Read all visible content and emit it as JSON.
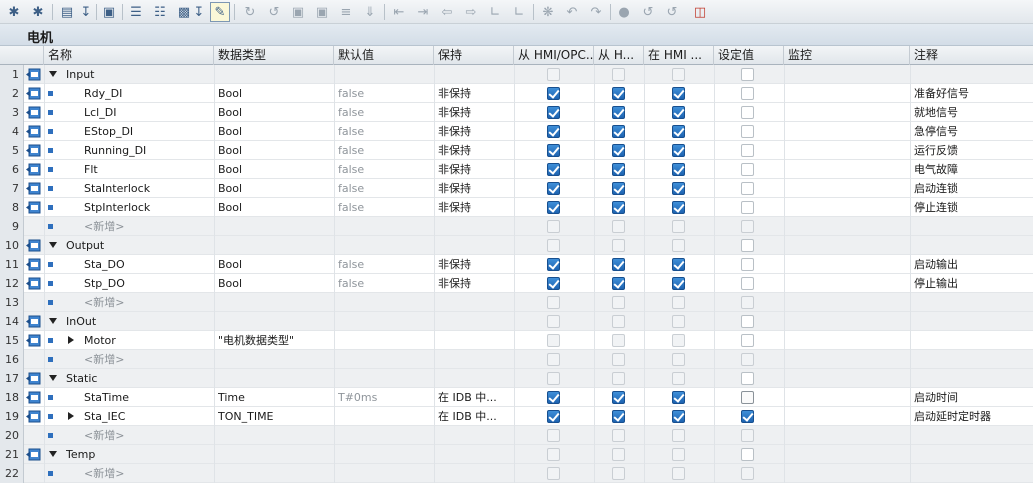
{
  "block_title": "电机",
  "toolbar": {
    "icons": [
      "insert-row-icon",
      "add-row-icon",
      "expand-icon",
      "monitor-icon",
      "list-icon",
      "download-icon",
      "snapshot-icon",
      "load-start-values-icon",
      "highlight-icon",
      "reset-icon",
      "jump-icon",
      "copy-icon",
      "paste-icon",
      "format-icon",
      "filter-icon",
      "indent-left-icon",
      "indent-right-icon",
      "outdent-icon",
      "sort-icon",
      "tree-icon",
      "comment-icon",
      "undo-icon",
      "redo-icon",
      "link-icon",
      "compare-icon",
      "compare2-icon",
      "db-icon"
    ]
  },
  "columns": [
    "名称",
    "数据类型",
    "默认值",
    "保持",
    "从 HMI/OPC...",
    "从 H...",
    "在 HMI ...",
    "设定值",
    "监控",
    "注释"
  ],
  "rows": [
    {
      "num": "1",
      "kind": "section",
      "name": "Input",
      "type": "",
      "default": "",
      "retain": "",
      "c1": "disabled",
      "c2": "disabled",
      "c3": "disabled",
      "c4": "off",
      "comment": ""
    },
    {
      "num": "2",
      "kind": "var",
      "name": "Rdy_DI",
      "type": "Bool",
      "default": "false",
      "retain": "非保持",
      "c1": "on",
      "c2": "on",
      "c3": "on",
      "c4": "off",
      "comment": "准备好信号"
    },
    {
      "num": "3",
      "kind": "var",
      "name": "Lcl_DI",
      "type": "Bool",
      "default": "false",
      "retain": "非保持",
      "c1": "on",
      "c2": "on",
      "c3": "on",
      "c4": "off",
      "comment": "就地信号"
    },
    {
      "num": "4",
      "kind": "var",
      "name": "EStop_DI",
      "type": "Bool",
      "default": "false",
      "retain": "非保持",
      "c1": "on",
      "c2": "on",
      "c3": "on",
      "c4": "off",
      "comment": "急停信号"
    },
    {
      "num": "5",
      "kind": "var",
      "name": "Running_DI",
      "type": "Bool",
      "default": "false",
      "retain": "非保持",
      "c1": "on",
      "c2": "on",
      "c3": "on",
      "c4": "off",
      "comment": "运行反馈"
    },
    {
      "num": "6",
      "kind": "var",
      "name": "Flt",
      "type": "Bool",
      "default": "false",
      "retain": "非保持",
      "c1": "on",
      "c2": "on",
      "c3": "on",
      "c4": "off",
      "comment": "电气故障"
    },
    {
      "num": "7",
      "kind": "var",
      "name": "StaInterlock",
      "type": "Bool",
      "default": "false",
      "retain": "非保持",
      "c1": "on",
      "c2": "on",
      "c3": "on",
      "c4": "off",
      "comment": "启动连锁"
    },
    {
      "num": "8",
      "kind": "var",
      "name": "StpInterlock",
      "type": "Bool",
      "default": "false",
      "retain": "非保持",
      "c1": "on",
      "c2": "on",
      "c3": "on",
      "c4": "off",
      "comment": "停止连锁"
    },
    {
      "num": "9",
      "kind": "new",
      "name": "<新增>",
      "type": "",
      "default": "",
      "retain": "",
      "c1": "disabled",
      "c2": "disabled",
      "c3": "disabled",
      "c4": "disabled",
      "comment": ""
    },
    {
      "num": "10",
      "kind": "section",
      "name": "Output",
      "type": "",
      "default": "",
      "retain": "",
      "c1": "disabled",
      "c2": "disabled",
      "c3": "disabled",
      "c4": "off",
      "comment": ""
    },
    {
      "num": "11",
      "kind": "var",
      "name": "Sta_DO",
      "type": "Bool",
      "default": "false",
      "retain": "非保持",
      "c1": "on",
      "c2": "on",
      "c3": "on",
      "c4": "off",
      "comment": "启动输出"
    },
    {
      "num": "12",
      "kind": "var",
      "name": "Stp_DO",
      "type": "Bool",
      "default": "false",
      "retain": "非保持",
      "c1": "on",
      "c2": "on",
      "c3": "on",
      "c4": "off",
      "comment": "停止输出"
    },
    {
      "num": "13",
      "kind": "new",
      "name": "<新增>",
      "type": "",
      "default": "",
      "retain": "",
      "c1": "disabled",
      "c2": "disabled",
      "c3": "disabled",
      "c4": "disabled",
      "comment": ""
    },
    {
      "num": "14",
      "kind": "section",
      "name": "InOut",
      "type": "",
      "default": "",
      "retain": "",
      "c1": "disabled",
      "c2": "disabled",
      "c3": "disabled",
      "c4": "off",
      "comment": ""
    },
    {
      "num": "15",
      "kind": "struct",
      "name": "Motor",
      "type": "\"电机数据类型\"",
      "default": "",
      "retain": "",
      "c1": "disabled",
      "c2": "disabled",
      "c3": "disabled",
      "c4": "off",
      "comment": ""
    },
    {
      "num": "16",
      "kind": "new",
      "name": "<新增>",
      "type": "",
      "default": "",
      "retain": "",
      "c1": "disabled",
      "c2": "disabled",
      "c3": "disabled",
      "c4": "disabled",
      "comment": ""
    },
    {
      "num": "17",
      "kind": "section",
      "name": "Static",
      "type": "",
      "default": "",
      "retain": "",
      "c1": "disabled",
      "c2": "disabled",
      "c3": "disabled",
      "c4": "off",
      "comment": ""
    },
    {
      "num": "18",
      "kind": "var",
      "name": "StaTime",
      "type": "Time",
      "default": "T#0ms",
      "retain": "在 IDB 中...",
      "c1": "on",
      "c2": "on",
      "c3": "on",
      "c4": "offstrong",
      "comment": "启动时间"
    },
    {
      "num": "19",
      "kind": "struct",
      "name": "Sta_IEC",
      "type": "TON_TIME",
      "default": "",
      "retain": "在 IDB 中...",
      "c1": "on",
      "c2": "on",
      "c3": "on",
      "c4": "on",
      "comment": "启动延时定时器"
    },
    {
      "num": "20",
      "kind": "new",
      "name": "<新增>",
      "type": "",
      "default": "",
      "retain": "",
      "c1": "disabled",
      "c2": "disabled",
      "c3": "disabled",
      "c4": "disabled",
      "comment": ""
    },
    {
      "num": "21",
      "kind": "section",
      "name": "Temp",
      "type": "",
      "default": "",
      "retain": "",
      "c1": "disabled",
      "c2": "disabled",
      "c3": "disabled",
      "c4": "off",
      "comment": ""
    },
    {
      "num": "22",
      "kind": "new",
      "name": "<新增>",
      "type": "",
      "default": "",
      "retain": "",
      "c1": "disabled",
      "c2": "disabled",
      "c3": "disabled",
      "c4": "disabled",
      "comment": ""
    }
  ]
}
